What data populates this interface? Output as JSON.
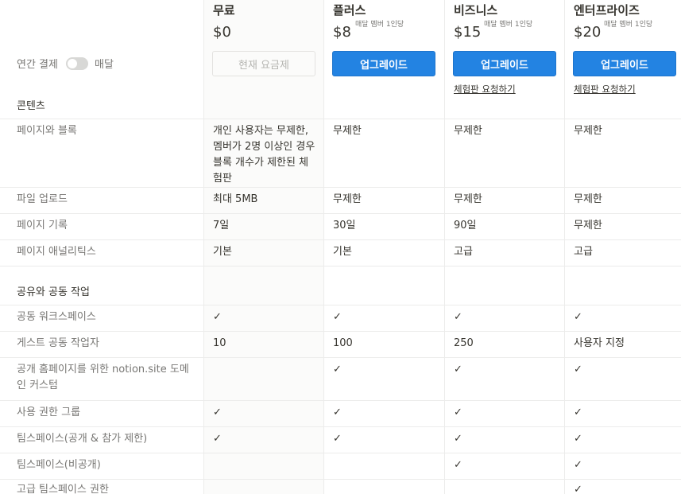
{
  "billing": {
    "left_label": "연간 결제",
    "right_label": "매달"
  },
  "plans": [
    {
      "name": "무료",
      "price": "$0",
      "note": "",
      "button": "현재 요금제",
      "trial": ""
    },
    {
      "name": "플러스",
      "price": "$8",
      "note": "매달 멤버 1인당",
      "button": "업그레이드",
      "trial": ""
    },
    {
      "name": "비즈니스",
      "price": "$15",
      "note": "매달 멤버 1인당",
      "button": "업그레이드",
      "trial": "체험판 요청하기"
    },
    {
      "name": "엔터프라이즈",
      "price": "$20",
      "note": "매달 멤버 1인당",
      "button": "업그레이드",
      "trial": "체험판 요청하기"
    }
  ],
  "sections": [
    {
      "title": "콘텐츠",
      "rows": [
        {
          "feature": "페이지와 블록",
          "values": [
            "개인 사용자는 무제한, 멤버가 2명 이상인 경우 블록 개수가 제한된 체험판",
            "무제한",
            "무제한",
            "무제한"
          ]
        },
        {
          "feature": "파일 업로드",
          "values": [
            "최대 5MB",
            "무제한",
            "무제한",
            "무제한"
          ]
        },
        {
          "feature": "페이지 기록",
          "values": [
            "7일",
            "30일",
            "90일",
            "무제한"
          ]
        },
        {
          "feature": "페이지 애널리틱스",
          "values": [
            "기본",
            "기본",
            "고급",
            "고급"
          ]
        }
      ]
    },
    {
      "title": "공유와 공동 작업",
      "rows": [
        {
          "feature": "공동 워크스페이스",
          "values": [
            "✓",
            "✓",
            "✓",
            "✓"
          ]
        },
        {
          "feature": "게스트 공동 작업자",
          "values": [
            "10",
            "100",
            "250",
            "사용자 지정"
          ]
        },
        {
          "feature": "공개 홈페이지를 위한 notion.site 도메인 커스텀",
          "values": [
            "",
            "✓",
            "✓",
            "✓"
          ]
        },
        {
          "feature": "사용 권한 그룹",
          "values": [
            "✓",
            "✓",
            "✓",
            "✓"
          ]
        },
        {
          "feature": "팀스페이스(공개 & 참가 제한)",
          "values": [
            "✓",
            "✓",
            "✓",
            "✓"
          ]
        },
        {
          "feature": "팀스페이스(비공개)",
          "values": [
            "",
            "",
            "✓",
            "✓"
          ]
        },
        {
          "feature": "고급 팀스페이스 권한",
          "values": [
            "",
            "",
            "",
            "✓"
          ]
        }
      ]
    }
  ]
}
